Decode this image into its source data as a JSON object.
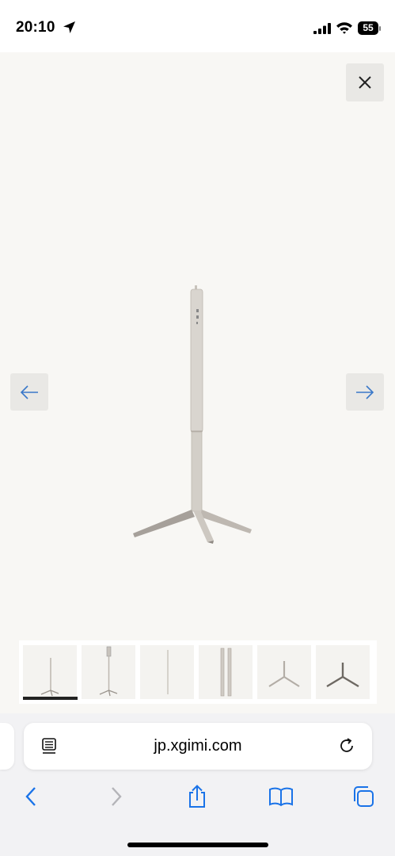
{
  "status_bar": {
    "time": "20:10",
    "battery": "55",
    "icons": [
      "location-arrow-icon",
      "cellular-signal-icon",
      "wifi-icon",
      "battery-icon"
    ]
  },
  "viewer": {
    "background": "#f8f7f4",
    "buttons": {
      "close": "close-icon",
      "prev": "arrow-left-icon",
      "next": "arrow-right-icon"
    },
    "accent_arrow_color": "#3a78c9",
    "product": "floor-stand-tripod-image",
    "thumbnails": [
      {
        "name": "thumbnail-stand-full",
        "selected": true
      },
      {
        "name": "thumbnail-stand-with-mount",
        "selected": false
      },
      {
        "name": "thumbnail-pole",
        "selected": false
      },
      {
        "name": "thumbnail-pole-segments",
        "selected": false
      },
      {
        "name": "thumbnail-tripod-base-light",
        "selected": false
      },
      {
        "name": "thumbnail-tripod-base-dark",
        "selected": false
      }
    ]
  },
  "browser": {
    "url": "jp.xgimi.com",
    "toolbar_color": "#1a73e8",
    "icons": [
      "reader-mode-icon",
      "reload-icon",
      "back-icon",
      "forward-icon",
      "share-icon",
      "bookmarks-icon",
      "tabs-icon"
    ]
  }
}
